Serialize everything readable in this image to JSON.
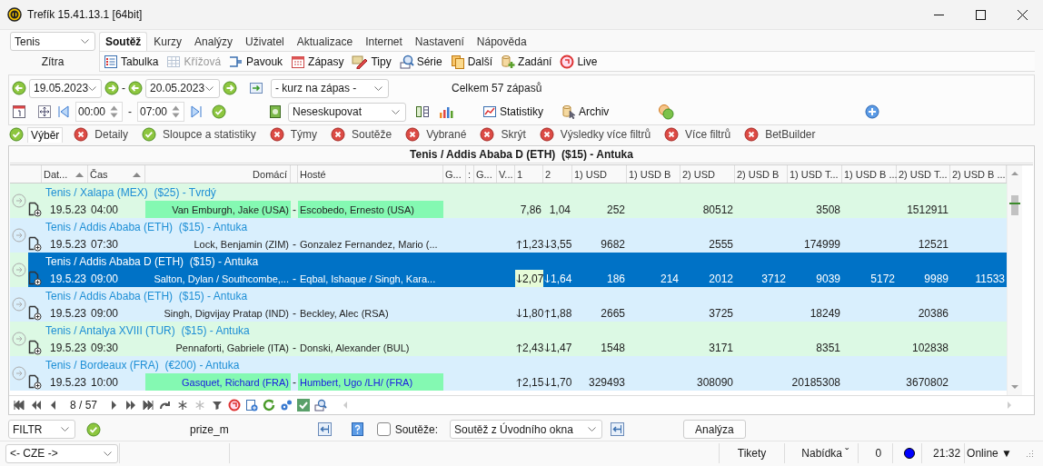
{
  "window": {
    "title": "Trefík 15.41.13.1 [64bit]"
  },
  "sport_select": {
    "value": "Tenis"
  },
  "day_label": "Zítra",
  "menu_tabs": [
    {
      "label": "Soutěž",
      "selected": true
    },
    {
      "label": "Kurzy",
      "selected": false
    },
    {
      "label": "Analýzy",
      "selected": false
    },
    {
      "label": "Uživatel",
      "selected": false
    },
    {
      "label": "Aktualizace",
      "selected": false
    },
    {
      "label": "Internet",
      "selected": false
    },
    {
      "label": "Nastavení",
      "selected": false
    },
    {
      "label": "Nápověda",
      "selected": false
    }
  ],
  "toolbar": [
    {
      "label": "Tabulka",
      "kind": "table",
      "disabled": false
    },
    {
      "label": "Křížová",
      "kind": "grid",
      "disabled": true
    },
    {
      "label": "Pavouk",
      "kind": "bracket",
      "disabled": false
    },
    {
      "label": "Zápasy",
      "kind": "calendar",
      "disabled": false
    },
    {
      "label": "Tipy",
      "kind": "tips",
      "disabled": false
    },
    {
      "label": "Série",
      "kind": "series",
      "disabled": false
    },
    {
      "label": "Další",
      "kind": "more",
      "disabled": false
    },
    {
      "label": "Zadání",
      "kind": "add",
      "disabled": false
    },
    {
      "label": "Live",
      "kind": "live",
      "disabled": false
    }
  ],
  "date_range": {
    "from": "19.05.2023",
    "separator": "-",
    "to": "20.05.2023"
  },
  "odds_select": {
    "value": "- kurz na zápas -"
  },
  "match_total": "Celkem 57 zápasů",
  "time_range": {
    "from": "00:00",
    "separator": "-",
    "to": "07:00"
  },
  "group_select": {
    "value": "Neseskupovat"
  },
  "actions": [
    {
      "label": "Statistiky",
      "kind": "chart"
    },
    {
      "label": "Archiv",
      "kind": "archive"
    }
  ],
  "filter_chips": [
    {
      "label": "Výběr",
      "enabled": true,
      "selected": true
    },
    {
      "label": "Detaily",
      "enabled": false,
      "selected": false
    },
    {
      "label": "Sloupce a statistiky",
      "enabled": true,
      "selected": false
    },
    {
      "label": "Týmy",
      "enabled": false,
      "selected": false
    },
    {
      "label": "Soutěže",
      "enabled": false,
      "selected": false
    },
    {
      "label": "Vybrané",
      "enabled": false,
      "selected": false
    },
    {
      "label": "Skrýt",
      "enabled": false,
      "selected": false
    },
    {
      "label": "Výsledky více filtrů",
      "enabled": false,
      "selected": false
    },
    {
      "label": "Více filtrů",
      "enabled": false,
      "selected": false
    },
    {
      "label": "BetBuilder",
      "enabled": false,
      "selected": false
    }
  ],
  "table": {
    "title": "Tenis / Addis Ababa D (ETH)  ($15) - Antuka",
    "columns": [
      {
        "label": "Dat...",
        "sorted": true
      },
      {
        "label": "Čas",
        "sorted": true
      },
      {
        "label": "Domácí"
      },
      {
        "label": "Hosté"
      },
      {
        "label": "G..."
      },
      {
        "label": ":"
      },
      {
        "label": "G..."
      },
      {
        "label": "V..."
      },
      {
        "label": "1"
      },
      {
        "label": "2"
      },
      {
        "label": "1) USD"
      },
      {
        "label": "1) USD B"
      },
      {
        "label": "2) USD"
      },
      {
        "label": "2) USD B"
      },
      {
        "label": "1) USD T..."
      },
      {
        "label": "1) USD B ..."
      },
      {
        "label": "2) USD T..."
      },
      {
        "label": "2) USD B ..."
      }
    ],
    "rows": [
      {
        "competition": "Tenis / Xalapa (MEX)  ($25) - Tvrdý",
        "date": "19.5.23",
        "time": "04:00",
        "home": "Van Emburgh, Jake (USA)",
        "dash": "-",
        "away": "Escobedo, Ernesto (USA)",
        "highlighted": true,
        "names_emphasized": false,
        "odd1": "7,86",
        "odd1_up": false,
        "odd1_down": false,
        "odd1_focused": false,
        "odd2": "1,04",
        "odd2_up": false,
        "odd2_down": false,
        "usd1": "252",
        "usd2": "80512",
        "usd1_t": "3508",
        "usd2_t": "1512911",
        "color": "#dcf9e4",
        "selected": false
      },
      {
        "competition": "Tenis / Addis Ababa (ETH)  ($15) - Antuka",
        "date": "19.5.23",
        "time": "07:30",
        "home": "Lock, Benjamin (ZIM)",
        "dash": "-",
        "away": "Gonzalez Fernandez, Mario (...",
        "highlighted": false,
        "names_emphasized": false,
        "odd1": "1,23",
        "odd1_up": true,
        "odd1_down": false,
        "odd1_focused": false,
        "odd2": "3,55",
        "odd2_up": false,
        "odd2_down": true,
        "usd1": "9682",
        "usd2": "2555",
        "usd1_t": "174999",
        "usd2_t": "12521",
        "color": "#d9effd",
        "selected": false
      },
      {
        "competition": "Tenis / Addis Ababa D (ETH)  ($15) - Antuka",
        "date": "19.5.23",
        "time": "09:00",
        "home": "Salton, Dylan / Southcombe,...",
        "dash": "-",
        "away": "Eqbal, Ishaque / Singh, Kara...",
        "highlighted": false,
        "names_emphasized": false,
        "odd1": "2,07",
        "odd1_up": false,
        "odd1_down": true,
        "odd1_focused": true,
        "odd2": "1,64",
        "odd2_up": false,
        "odd2_down": true,
        "usd1": "186",
        "usd1_b": "214",
        "usd2": "2012",
        "usd2_b": "3712",
        "usd1_t": "9039",
        "usd1_bt": "5172",
        "usd2_t": "9989",
        "usd2_bt": "11533",
        "color": "#dcf9e4",
        "selected": true
      },
      {
        "competition": "Tenis / Addis Ababa (ETH)  ($15) - Antuka",
        "date": "19.5.23",
        "time": "09:00",
        "home": "Singh, Digvijay Pratap (IND)",
        "dash": "-",
        "away": "Beckley, Alec (RSA)",
        "highlighted": false,
        "names_emphasized": false,
        "odd1": "1,80",
        "odd1_up": false,
        "odd1_down": true,
        "odd1_focused": false,
        "odd2": "1,88",
        "odd2_up": true,
        "odd2_down": false,
        "usd1": "2665",
        "usd2": "3725",
        "usd1_t": "18249",
        "usd2_t": "20386",
        "color": "#d9effd",
        "selected": false
      },
      {
        "competition": "Tenis / Antalya XVIII (TUR)  ($15) - Antuka",
        "date": "19.5.23",
        "time": "09:30",
        "home": "Pennaforti, Gabriele (ITA)",
        "dash": "-",
        "away": "Donski, Alexander (BUL)",
        "highlighted": false,
        "names_emphasized": false,
        "odd1": "2,43",
        "odd1_up": true,
        "odd1_down": false,
        "odd1_focused": false,
        "odd2": "1,47",
        "odd2_up": false,
        "odd2_down": true,
        "usd1": "1548",
        "usd2": "3171",
        "usd1_t": "8351",
        "usd2_t": "102838",
        "color": "#dcf9e4",
        "selected": false
      },
      {
        "competition": "Tenis / Bordeaux (FRA)  (€200) - Antuka",
        "date": "19.5.23",
        "time": "10:00",
        "home": "Gasquet, Richard (FRA)",
        "dash": "-",
        "away": "Humbert, Ugo /LH/ (FRA)",
        "highlighted": true,
        "names_emphasized": true,
        "odd1": "2,15",
        "odd1_up": true,
        "odd1_down": false,
        "odd1_focused": false,
        "odd2": "1,70",
        "odd2_up": false,
        "odd2_down": true,
        "usd1": "329493",
        "usd2": "308090",
        "usd1_t": "20185308",
        "usd2_t": "3670802",
        "color": "#d9effd",
        "selected": false
      }
    ]
  },
  "navigator": {
    "counter": "8 / 57"
  },
  "filter_bar": {
    "filter_select": "FILTR",
    "field_name": "prize_m",
    "competitions_checkbox": {
      "label": "Soutěže:",
      "checked": false
    },
    "competitions_select": "Soutěž z Úvodního okna",
    "button": "Analýza"
  },
  "status_bar": {
    "language_select": "<- CZE ->",
    "tickets": "Tikety",
    "offer": "Nabídka ˇ",
    "count": "0",
    "time": "21:32",
    "connection": "Online ▼"
  }
}
